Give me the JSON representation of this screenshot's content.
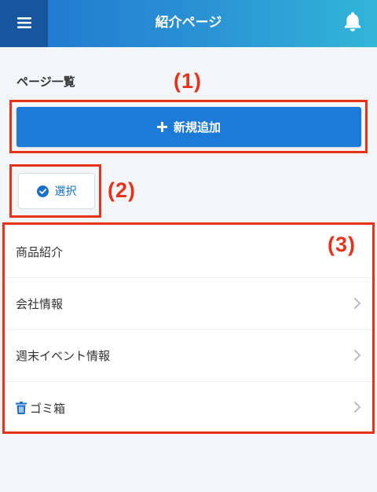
{
  "header": {
    "title": "紹介ページ",
    "menu_icon": "hamburger-icon",
    "bell_icon": "bell-icon"
  },
  "section": {
    "title": "ページ一覧"
  },
  "actions": {
    "add_label": "新規追加",
    "select_label": "選択"
  },
  "list": {
    "items": [
      {
        "label": "商品紹介",
        "chevron": false
      },
      {
        "label": "会社情報",
        "chevron": true
      },
      {
        "label": "週末イベント情報",
        "chevron": true
      },
      {
        "label": "ゴミ箱",
        "chevron": true,
        "icon": "trash-icon"
      }
    ]
  },
  "callouts": [
    "(1)",
    "(2)",
    "(3)"
  ],
  "colors": {
    "primary": "#1c7ad8",
    "header_dark": "#16569e",
    "callout_red": "#e8321c",
    "background": "#f3f6f9"
  }
}
